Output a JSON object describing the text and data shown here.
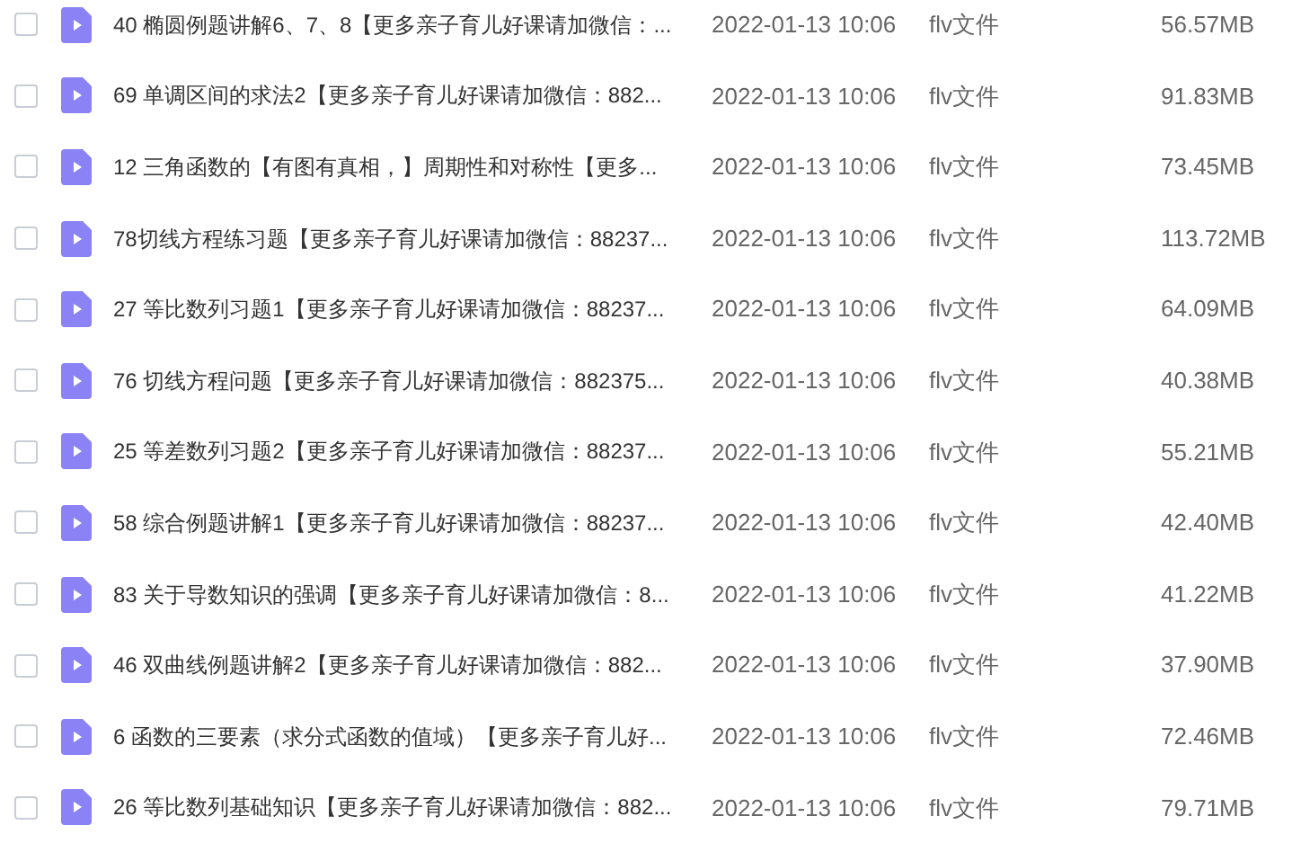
{
  "files": [
    {
      "checked": false,
      "name": "40 椭圆例题讲解6、7、8【更多亲子育儿好课请加微信：...",
      "date": "2022-01-13 10:06",
      "type": "flv文件",
      "size": "56.57MB"
    },
    {
      "checked": false,
      "name": "69 单调区间的求法2【更多亲子育儿好课请加微信：882...",
      "date": "2022-01-13 10:06",
      "type": "flv文件",
      "size": "91.83MB"
    },
    {
      "checked": false,
      "name": "12 三角函数的【有图有真相，】周期性和对称性【更多...",
      "date": "2022-01-13 10:06",
      "type": "flv文件",
      "size": "73.45MB"
    },
    {
      "checked": false,
      "name": "78切线方程练习题【更多亲子育儿好课请加微信：88237...",
      "date": "2022-01-13 10:06",
      "type": "flv文件",
      "size": "113.72MB"
    },
    {
      "checked": false,
      "name": "27 等比数列习题1【更多亲子育儿好课请加微信：88237...",
      "date": "2022-01-13 10:06",
      "type": "flv文件",
      "size": "64.09MB"
    },
    {
      "checked": false,
      "name": "76 切线方程问题【更多亲子育儿好课请加微信：882375...",
      "date": "2022-01-13 10:06",
      "type": "flv文件",
      "size": "40.38MB"
    },
    {
      "checked": false,
      "name": "25 等差数列习题2【更多亲子育儿好课请加微信：88237...",
      "date": "2022-01-13 10:06",
      "type": "flv文件",
      "size": "55.21MB"
    },
    {
      "checked": false,
      "name": "58 综合例题讲解1【更多亲子育儿好课请加微信：88237...",
      "date": "2022-01-13 10:06",
      "type": "flv文件",
      "size": "42.40MB"
    },
    {
      "checked": false,
      "name": "83 关于导数知识的强调【更多亲子育儿好课请加微信：8...",
      "date": "2022-01-13 10:06",
      "type": "flv文件",
      "size": "41.22MB"
    },
    {
      "checked": false,
      "name": "46 双曲线例题讲解2【更多亲子育儿好课请加微信：882...",
      "date": "2022-01-13 10:06",
      "type": "flv文件",
      "size": "37.90MB"
    },
    {
      "checked": false,
      "name": "6 函数的三要素（求分式函数的值域）【更多亲子育儿好...",
      "date": "2022-01-13 10:06",
      "type": "flv文件",
      "size": "72.46MB"
    },
    {
      "checked": false,
      "name": "26 等比数列基础知识【更多亲子育儿好课请加微信：882...",
      "date": "2022-01-13 10:06",
      "type": "flv文件",
      "size": "79.71MB"
    }
  ]
}
